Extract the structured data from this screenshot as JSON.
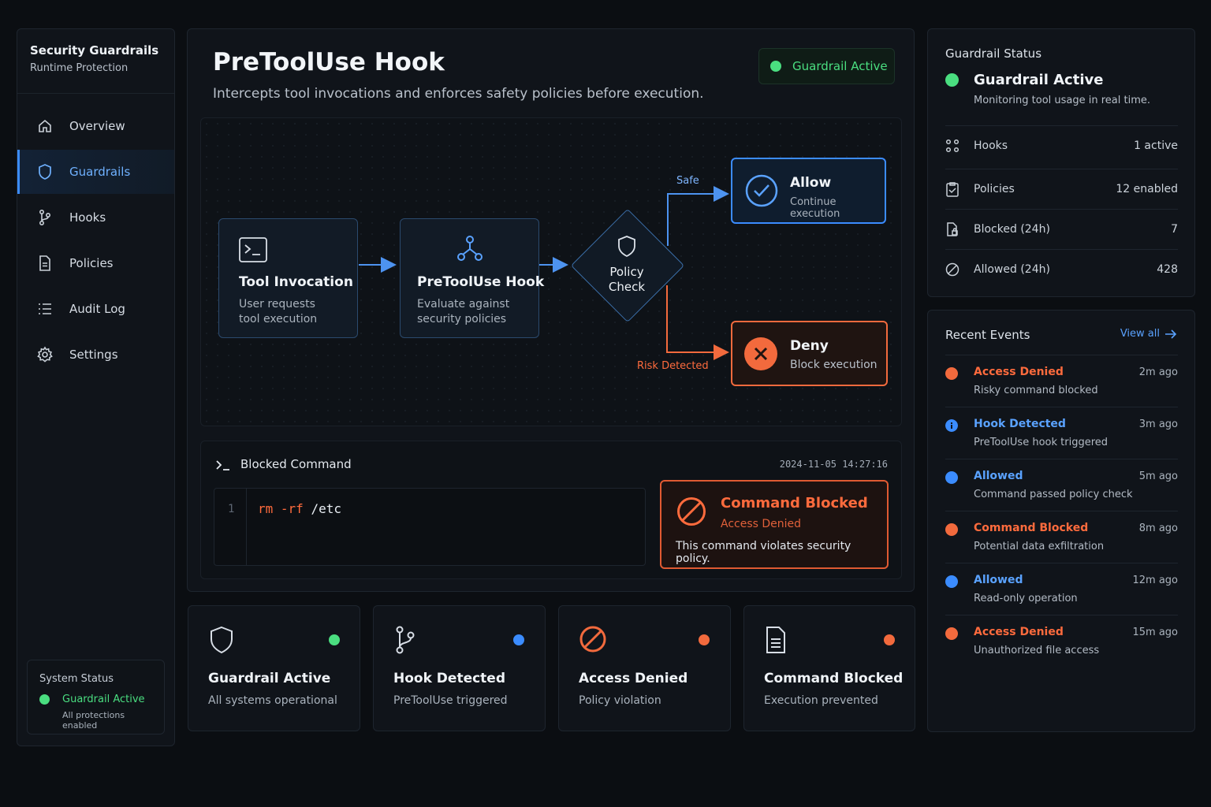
{
  "sidebar": {
    "title": "Security Guardrails",
    "subtitle": "Runtime Protection",
    "items": [
      {
        "label": "Overview",
        "icon": "home-icon"
      },
      {
        "label": "Guardrails",
        "icon": "shield-icon",
        "active": true
      },
      {
        "label": "Hooks",
        "icon": "branch-icon"
      },
      {
        "label": "Policies",
        "icon": "document-icon"
      },
      {
        "label": "Audit Log",
        "icon": "list-icon"
      },
      {
        "label": "Settings",
        "icon": "gear-icon"
      }
    ],
    "system_status": {
      "title": "System Status",
      "state": "Guardrail Active",
      "detail": "All protections enabled"
    }
  },
  "main": {
    "title": "PreToolUse Hook",
    "description": "Intercepts tool invocations and enforces safety policies before execution.",
    "badge": "Guardrail Active",
    "flow": {
      "tool_invocation": {
        "title": "Tool Invocation",
        "line1": "User requests",
        "line2": "tool execution"
      },
      "hook": {
        "title": "PreToolUse Hook",
        "line1": "Evaluate against",
        "line2": "security policies"
      },
      "policy_check": {
        "line1": "Policy",
        "line2": "Check"
      },
      "safe_label": "Safe",
      "risk_label": "Risk Detected",
      "allow": {
        "title": "Allow",
        "sub": "Continue execution"
      },
      "deny": {
        "title": "Deny",
        "sub": "Block execution"
      }
    },
    "blocked_command": {
      "title": "Blocked Command",
      "timestamp": "2024-11-05 14:27:16",
      "line_number": "1",
      "cmd": "rm",
      "flag": "-rf",
      "path": "/etc",
      "card_title": "Command Blocked",
      "card_sub": "Access Denied",
      "card_desc": "This command violates security policy."
    }
  },
  "cards": [
    {
      "title": "Guardrail Active",
      "sub": "All systems operational"
    },
    {
      "title": "Hook Detected",
      "sub": "PreToolUse triggered"
    },
    {
      "title": "Access Denied",
      "sub": "Policy violation"
    },
    {
      "title": "Command Blocked",
      "sub": "Execution prevented"
    }
  ],
  "status": {
    "title": "Guardrail Status",
    "state": "Guardrail Active",
    "desc": "Monitoring tool usage in real time.",
    "stats": [
      {
        "label": "Hooks",
        "value": "1 active"
      },
      {
        "label": "Policies",
        "value": "12 enabled"
      },
      {
        "label": "Blocked (24h)",
        "value": "7"
      },
      {
        "label": "Allowed (24h)",
        "value": "428"
      }
    ]
  },
  "events": {
    "title": "Recent Events",
    "view_all": "View all",
    "items": [
      {
        "name": "Access Denied",
        "time": "2m ago",
        "sub": "Risky command blocked",
        "kind": "denied"
      },
      {
        "name": "Hook Detected",
        "time": "3m ago",
        "sub": "PreToolUse hook triggered",
        "kind": "info"
      },
      {
        "name": "Allowed",
        "time": "5m ago",
        "sub": "Command passed policy check",
        "kind": "allowed"
      },
      {
        "name": "Command Blocked",
        "time": "8m ago",
        "sub": "Potential data exfiltration",
        "kind": "denied"
      },
      {
        "name": "Allowed",
        "time": "12m ago",
        "sub": "Read-only operation",
        "kind": "allowed"
      },
      {
        "name": "Access Denied",
        "time": "15m ago",
        "sub": "Unauthorized file access",
        "kind": "denied"
      }
    ]
  },
  "colors": {
    "green": "#4ade80",
    "blue": "#3b8cff",
    "orange": "#f26a3d",
    "blue_text": "#5aa2ff",
    "orange_text": "#ff6b3d"
  }
}
